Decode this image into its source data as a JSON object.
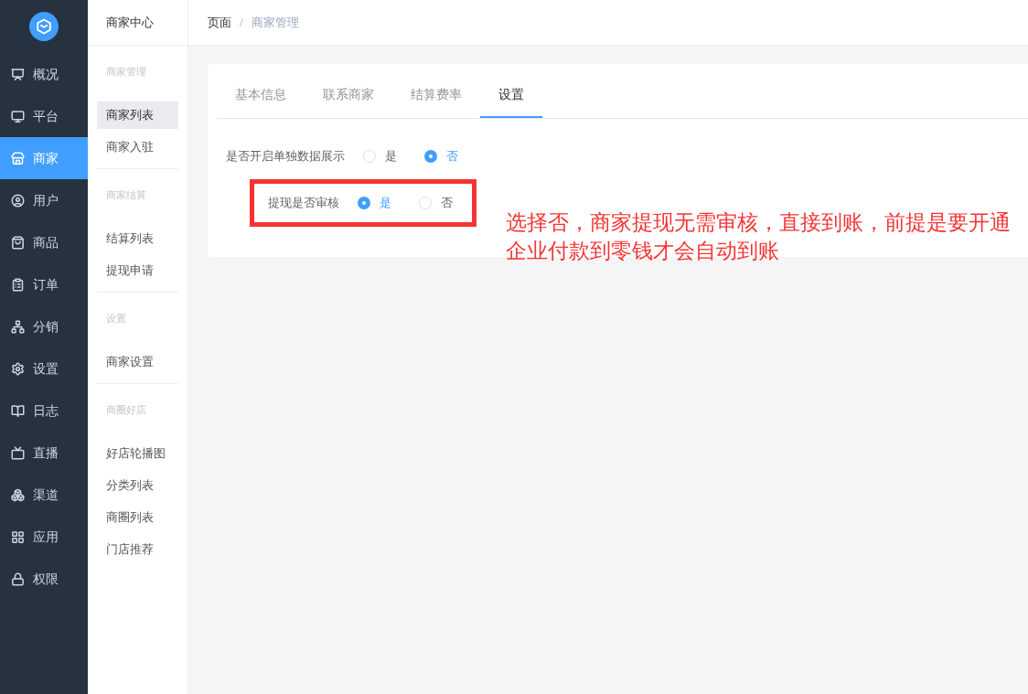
{
  "sidebar": {
    "items": [
      {
        "label": "概况",
        "selected": false
      },
      {
        "label": "平台",
        "selected": false
      },
      {
        "label": "商家",
        "selected": true
      },
      {
        "label": "用户",
        "selected": false
      },
      {
        "label": "商品",
        "selected": false
      },
      {
        "label": "订单",
        "selected": false
      },
      {
        "label": "分销",
        "selected": false
      },
      {
        "label": "设置",
        "selected": false
      },
      {
        "label": "日志",
        "selected": false
      },
      {
        "label": "直播",
        "selected": false
      },
      {
        "label": "渠道",
        "selected": false
      },
      {
        "label": "应用",
        "selected": false
      },
      {
        "label": "权限",
        "selected": false
      }
    ]
  },
  "submenu": {
    "title": "商家中心",
    "groups": [
      {
        "title": "商家管理",
        "items": [
          {
            "label": "商家列表",
            "selected": true
          },
          {
            "label": "商家入驻",
            "selected": false
          }
        ]
      },
      {
        "title": "商家结算",
        "items": [
          {
            "label": "结算列表",
            "selected": false
          },
          {
            "label": "提现申请",
            "selected": false
          }
        ]
      },
      {
        "title": "设置",
        "items": [
          {
            "label": "商家设置",
            "selected": false
          }
        ]
      },
      {
        "title": "商圈好店",
        "items": [
          {
            "label": "好店轮播图",
            "selected": false
          },
          {
            "label": "分类列表",
            "selected": false
          },
          {
            "label": "商圈列表",
            "selected": false
          },
          {
            "label": "门店推荐",
            "selected": false
          }
        ]
      }
    ]
  },
  "breadcrumb": {
    "items": [
      "页面",
      "商家管理"
    ],
    "separator": "/"
  },
  "tabs": [
    {
      "label": "基本信息",
      "selected": false
    },
    {
      "label": "联系商家",
      "selected": false
    },
    {
      "label": "结算费率",
      "selected": false
    },
    {
      "label": "设置",
      "selected": true
    }
  ],
  "form": {
    "fields": [
      {
        "label": "是否开启单独数据展示",
        "highlighted": false,
        "options": [
          {
            "label": "是",
            "selected": false
          },
          {
            "label": "否",
            "selected": true
          }
        ]
      },
      {
        "label": "提现是否审核",
        "highlighted": true,
        "options": [
          {
            "label": "是",
            "selected": true
          },
          {
            "label": "否",
            "selected": false
          }
        ]
      }
    ]
  },
  "annotation": "选择否，商家提现无需审核，直接到账，前提是要开通企业付款到零钱才会自动到账"
}
